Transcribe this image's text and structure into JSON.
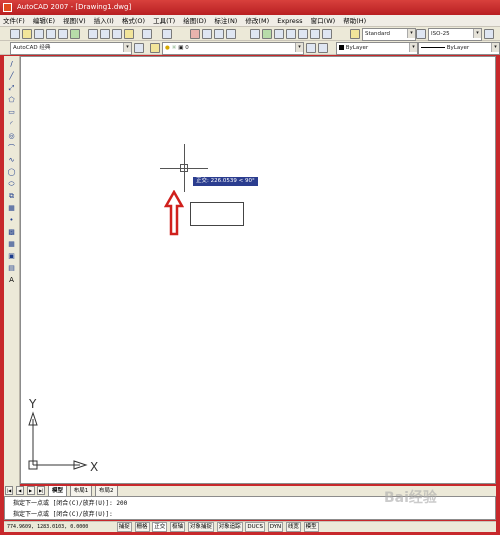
{
  "window": {
    "title": "AutoCAD 2007 - [Drawing1.dwg]"
  },
  "menu": [
    "文件(F)",
    "编辑(E)",
    "视图(V)",
    "插入(I)",
    "格式(O)",
    "工具(T)",
    "绘图(D)",
    "标注(N)",
    "修改(M)",
    "Express",
    "窗口(W)",
    "帮助(H)"
  ],
  "toolbar": {
    "text_style": "Standard",
    "dim_style": "ISO-25",
    "workspace": "AutoCAD 经典",
    "layer": "0",
    "color": "ByLayer",
    "linetype": "ByLayer"
  },
  "left_toolbar": [
    "/",
    "╱",
    "⤢",
    "⬠",
    "▭",
    "◜",
    "◎",
    "⌒",
    "∿",
    "◯",
    "⬭",
    "⧉",
    "▦",
    "•",
    "▩",
    "▦",
    "▣",
    "▤",
    "A"
  ],
  "drawing": {
    "tooltip": "正交: 226.0539 < 90°",
    "ucs_y": "Y",
    "ucs_x": "X"
  },
  "tabs": {
    "model": "模型",
    "layout1": "布局1",
    "layout2": "布局2"
  },
  "command": {
    "line1": "指定下一点或 [闭合(C)/放弃(U)]: 200",
    "line2": "指定下一点或 [闭合(C)/放弃(U)]:"
  },
  "status": {
    "coords": "774.9609, 1283.0103, 0.0000",
    "buttons": [
      "捕捉",
      "栅格",
      "正交",
      "极轴",
      "对象捕捉",
      "对象追踪",
      "DUCS",
      "DYN",
      "线宽",
      "模型"
    ]
  },
  "watermark": "Bai经验"
}
